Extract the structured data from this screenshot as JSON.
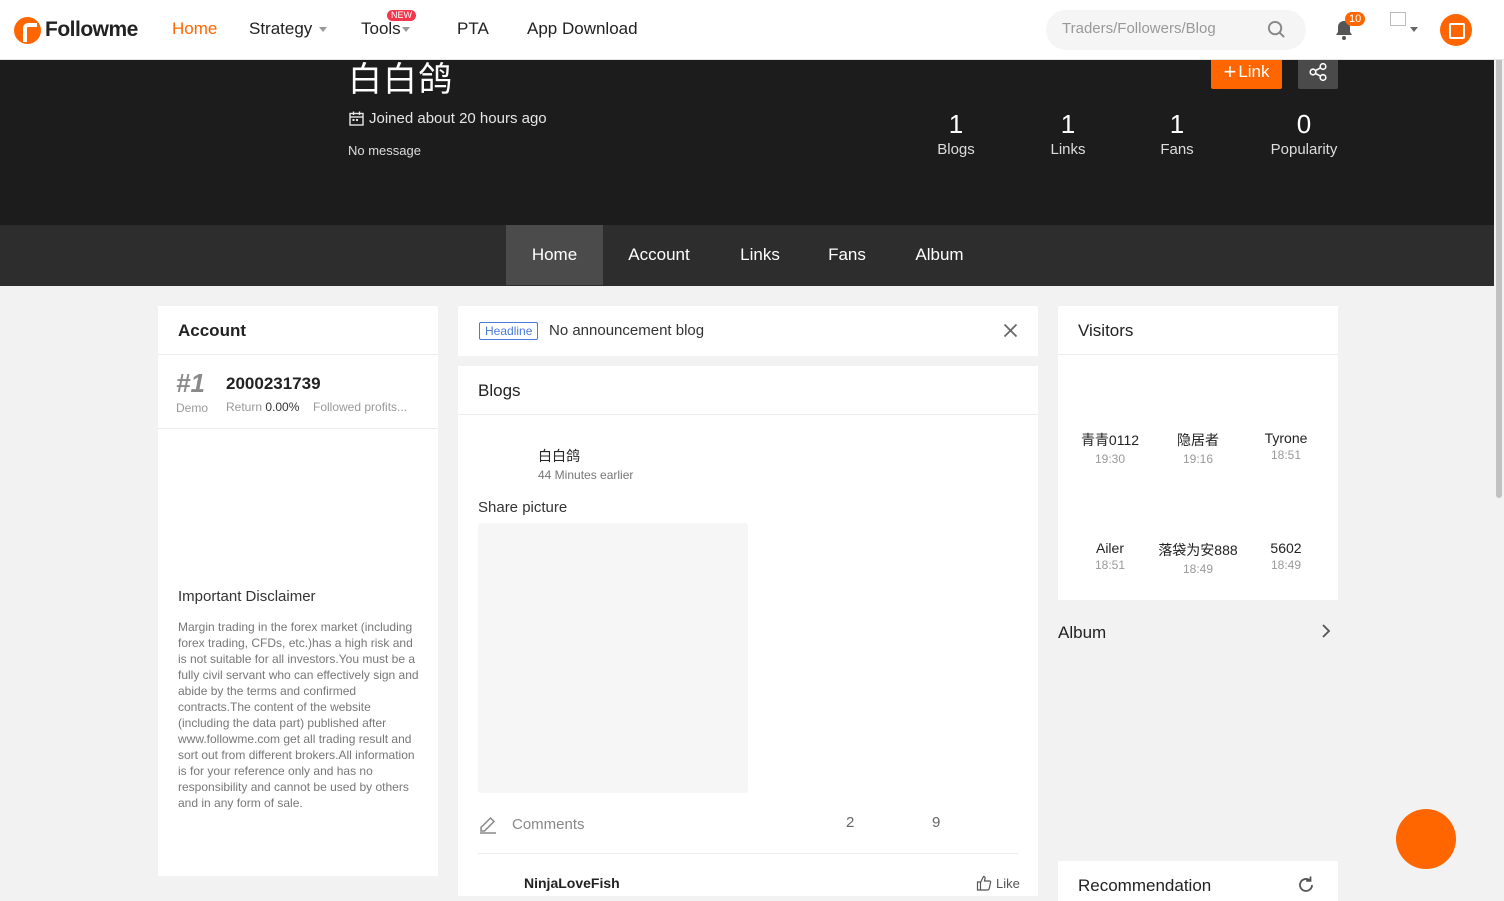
{
  "nav": {
    "logo": "Followme",
    "items": [
      {
        "label": "Home",
        "active": true
      },
      {
        "label": "Strategy"
      },
      {
        "label": "Tools",
        "badge": "NEW"
      },
      {
        "label": "PTA"
      },
      {
        "label": "App Download"
      }
    ],
    "search_placeholder": "Traders/Followers/Blog",
    "notifications": "10"
  },
  "profile": {
    "name": "白白鸽",
    "joined": "Joined about 20 hours ago",
    "message": "No message",
    "link_label": "Link",
    "stats": [
      {
        "num": "1",
        "label": "Blogs"
      },
      {
        "num": "1",
        "label": "Links"
      },
      {
        "num": "1",
        "label": "Fans"
      },
      {
        "num": "0",
        "label": "Popularity"
      }
    ]
  },
  "tabs": [
    {
      "label": "Home",
      "active": true
    },
    {
      "label": "Account"
    },
    {
      "label": "Links"
    },
    {
      "label": "Fans"
    },
    {
      "label": "Album"
    }
  ],
  "account": {
    "title": "Account",
    "rank": "#1",
    "type": "Demo",
    "id": "2000231739",
    "return_label": "Return",
    "return_value": "0.00%",
    "followed": "Followed profits...",
    "disclaimer_title": "Important Disclaimer",
    "disclaimer_text": "Margin trading in the forex market (including forex trading, CFDs, etc.)has a high risk and is not suitable for all investors.You must be a fully civil servant who can effectively sign and abide by the terms and confirmed contracts.The content of the website (including the data part) published after www.followme.com get all trading result and sort out from different brokers.All information is for your reference only and has no responsibility and cannot be used by others and in any form of sale."
  },
  "headline": {
    "tag": "Headline",
    "text": "No announcement blog"
  },
  "blogs": {
    "title": "Blogs",
    "post": {
      "author": "白白鸽",
      "time": "44 Minutes earlier",
      "text": "Share picture",
      "comments_label": "Comments",
      "count1": "2",
      "count2": "9"
    },
    "comment": {
      "author": "NinjaLoveFish",
      "like_label": "Like"
    }
  },
  "visitors": {
    "title": "Visitors",
    "items": [
      {
        "name": "青青0112",
        "time": "19:30"
      },
      {
        "name": "隐居者",
        "time": "19:16"
      },
      {
        "name": "Tyrone",
        "time": "18:51"
      },
      {
        "name": "Ailer",
        "time": "18:51"
      },
      {
        "name": "落袋为安888",
        "time": "18:49"
      },
      {
        "name": "5602",
        "time": "18:49"
      }
    ]
  },
  "album": {
    "title": "Album"
  },
  "recommendation": {
    "title": "Recommendation"
  },
  "colors": {
    "accent": "#ff6600",
    "banner": "#1c1c1c",
    "tabbar": "#2d2d2d"
  }
}
